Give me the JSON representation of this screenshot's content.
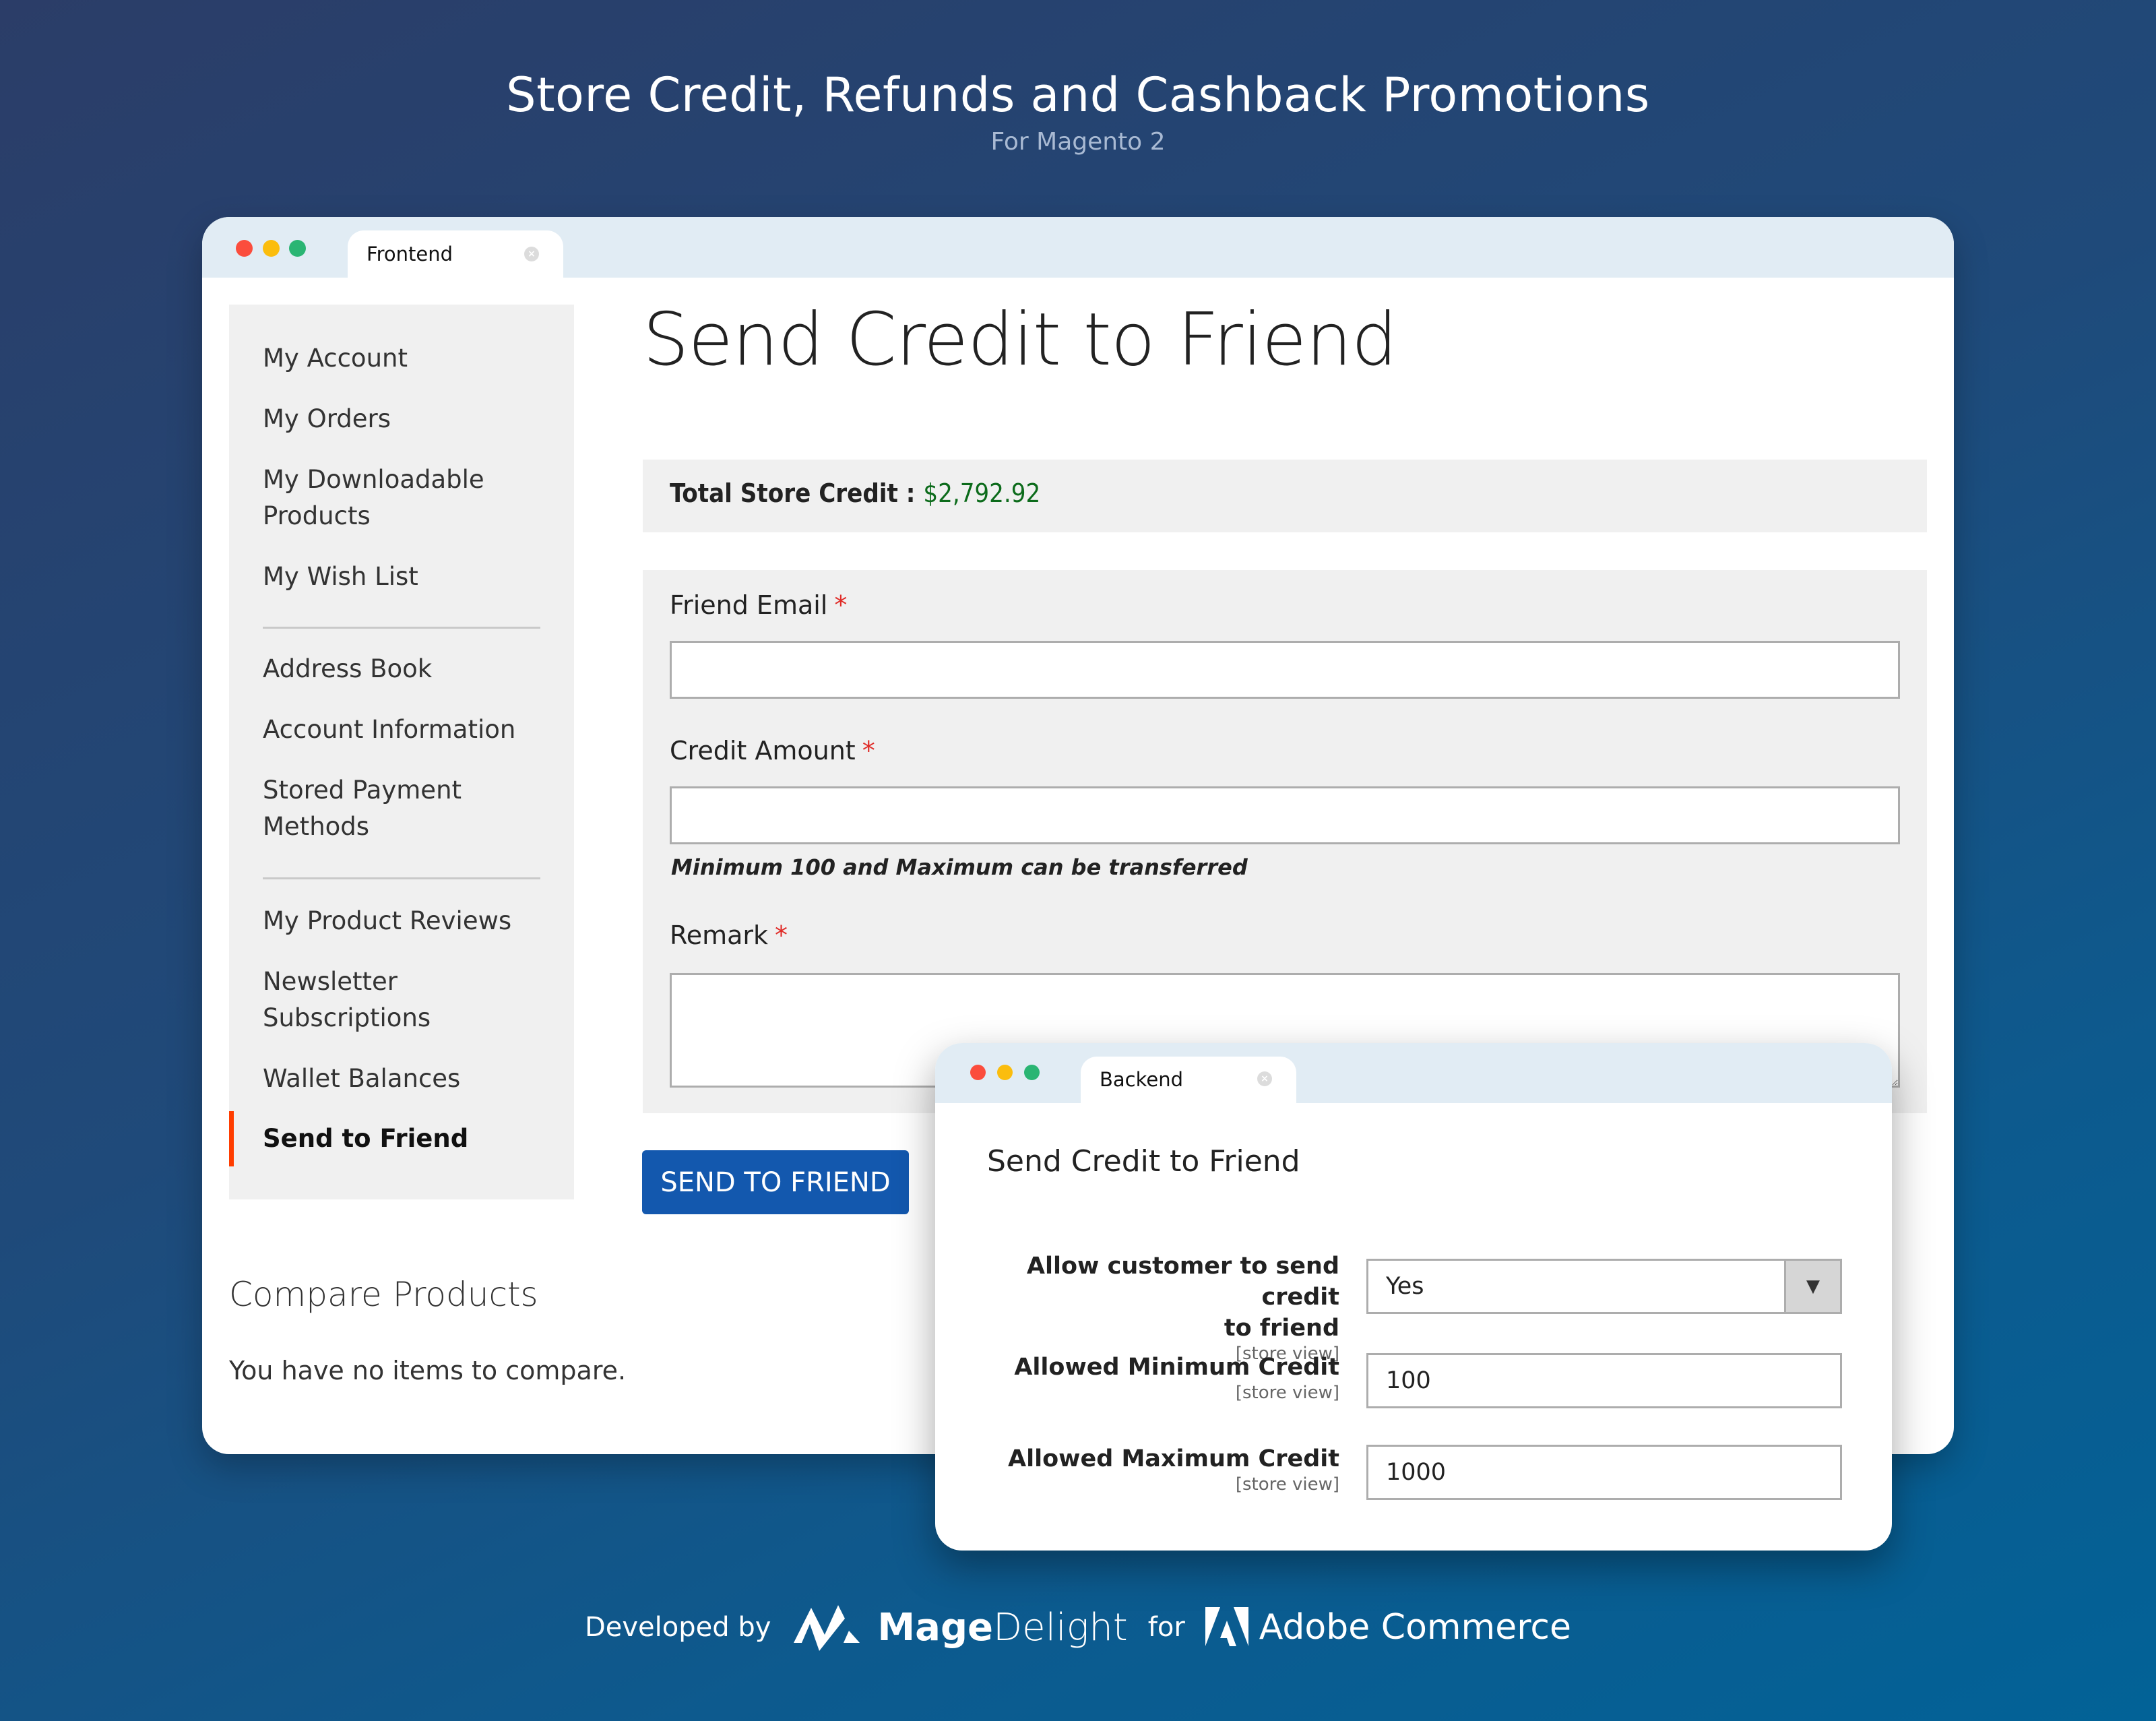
{
  "hero": {
    "title": "Store Credit, Refunds and Cashback Promotions",
    "subtitle": "For Magento 2"
  },
  "colors": {
    "accent_blue": "#1358ae",
    "active_marker": "#ff3d00",
    "credit_green": "#0c6b1b",
    "required_red": "#e02b27",
    "titlebar": "#e1ecf4",
    "dot_red": "#fb4d3d",
    "dot_yellow": "#fbbd0d",
    "dot_green": "#2ab573"
  },
  "frontend": {
    "tab_label": "Frontend",
    "sidebar": {
      "items": [
        {
          "label": "My Account"
        },
        {
          "label": "My Orders"
        },
        {
          "label": "My Downloadable Products"
        },
        {
          "label": "My Wish List"
        },
        {
          "label": "Address Book"
        },
        {
          "label": "Account Information"
        },
        {
          "label": "Stored Payment Methods"
        },
        {
          "label": "My Product Reviews"
        },
        {
          "label": "Newsletter Subscriptions"
        },
        {
          "label": "Wallet Balances"
        },
        {
          "label": "Send to Friend",
          "active": true
        }
      ]
    },
    "page_title": "Send Credit to Friend",
    "total_credit_label": "Total Store Credit :",
    "total_credit_value": "$2,792.92",
    "form": {
      "friend_email": {
        "label": "Friend Email",
        "required": "*",
        "value": ""
      },
      "credit_amount": {
        "label": "Credit Amount",
        "required": "*",
        "value": "",
        "note": "Minimum 100 and Maximum can be transferred"
      },
      "remark": {
        "label": "Remark",
        "required": "*",
        "value": ""
      }
    },
    "submit_label": "SEND TO FRIEND",
    "compare": {
      "title": "Compare Products",
      "empty_text": "You have no items to compare."
    }
  },
  "backend": {
    "tab_label": "Backend",
    "section_title": "Send Credit to Friend",
    "fields": [
      {
        "label_line1": "Allow customer to send credit",
        "label_line2": "to friend",
        "scope": "[store view]",
        "value": "Yes",
        "type": "select"
      },
      {
        "label_line1": "Allowed Minimum Credit",
        "scope": "[store view]",
        "value": "100",
        "type": "text"
      },
      {
        "label_line1": "Allowed Maximum Credit",
        "scope": "[store view]",
        "value": "1000",
        "type": "text"
      }
    ]
  },
  "footer": {
    "developed_by": "Developed by",
    "brand_bold": "Mage",
    "brand_light": "Delight",
    "for": "for",
    "platform": "Adobe Commerce"
  }
}
